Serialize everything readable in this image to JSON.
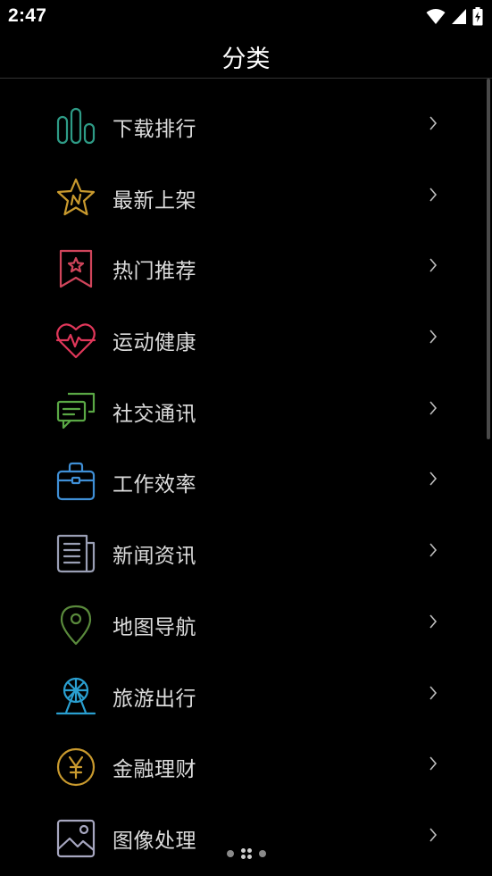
{
  "status_bar": {
    "time": "2:47",
    "icons": [
      "wifi-icon",
      "signal-icon",
      "battery-charging-icon"
    ]
  },
  "app_bar": {
    "title": "分类"
  },
  "categories": [
    {
      "label": "下载排行",
      "icon": "bar-chart-icon",
      "color": "#2e9b86"
    },
    {
      "label": "最新上架",
      "icon": "new-star-icon",
      "color": "#c99a2e"
    },
    {
      "label": "热门推荐",
      "icon": "bookmark-star-icon",
      "color": "#d0455b"
    },
    {
      "label": "运动健康",
      "icon": "heart-pulse-icon",
      "color": "#e0375a"
    },
    {
      "label": "社交通讯",
      "icon": "chat-bubbles-icon",
      "color": "#5aa845"
    },
    {
      "label": "工作效率",
      "icon": "briefcase-icon",
      "color": "#3f8fd6"
    },
    {
      "label": "新闻资讯",
      "icon": "newspaper-icon",
      "color": "#9a9fb5"
    },
    {
      "label": "地图导航",
      "icon": "map-pin-icon",
      "color": "#5a8a3c"
    },
    {
      "label": "旅游出行",
      "icon": "ferris-wheel-icon",
      "color": "#2a9fd0"
    },
    {
      "label": "金融理财",
      "icon": "yen-coin-icon",
      "color": "#c99a2e"
    },
    {
      "label": "图像处理",
      "icon": "image-icon",
      "color": "#a7a7c0"
    }
  ],
  "chevron": "chevron-right-icon"
}
